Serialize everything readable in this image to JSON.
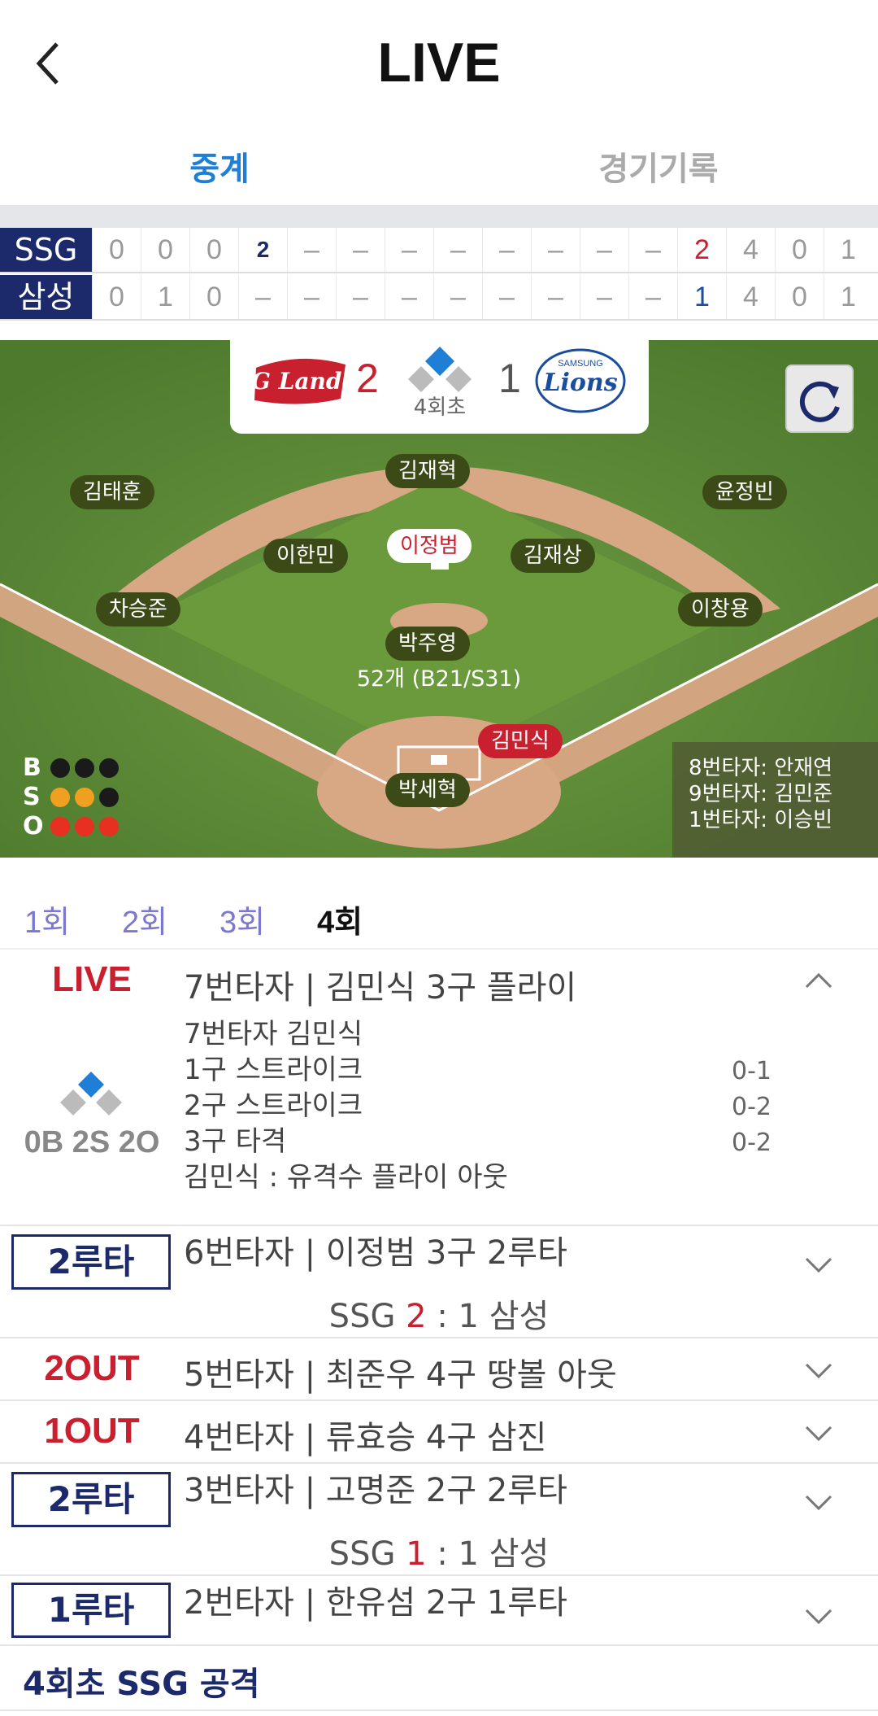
{
  "header": {
    "title": "LIVE",
    "back_icon": "back-arrow-icon"
  },
  "tabs": [
    {
      "label": "중계",
      "active": true
    },
    {
      "label": "경기기록",
      "active": false
    }
  ],
  "scoreboard": {
    "rows": [
      {
        "team": "SSG",
        "innings": [
          "0",
          "0",
          "0",
          "2",
          "–",
          "–",
          "–",
          "–",
          "–",
          "–",
          "–",
          "–"
        ],
        "totals": [
          "2",
          "4",
          "0",
          "1"
        ]
      },
      {
        "team": "삼성",
        "innings": [
          "0",
          "1",
          "0",
          "–",
          "–",
          "–",
          "–",
          "–",
          "–",
          "–",
          "–",
          "–"
        ],
        "totals": [
          "1",
          "4",
          "0",
          "1"
        ]
      }
    ]
  },
  "game": {
    "away_logo": "SSG Landers",
    "away_score": "2",
    "inning": "4회초",
    "home_score": "1",
    "home_logo": "Lions",
    "home_logo_sub": "SAMSUNG",
    "refresh_icon": "refresh-icon"
  },
  "field": {
    "cf": "김재혁",
    "lf": "김태훈",
    "rf": "윤정빈",
    "ss": "이한민",
    "runner2b": "이정범",
    "b2": "김재상",
    "b3": "차승준",
    "b1": "이창용",
    "pitcher": "박주영",
    "pitch_count": "52개 (B21/S31)",
    "batter": "김민식",
    "catcher": "박세혁",
    "next_batters": [
      "8번타자: 안재연",
      "9번타자: 김민준",
      "1번타자: 이승빈"
    ],
    "count_labels": [
      "B",
      "S",
      "O"
    ]
  },
  "innings_tabs": [
    "1회",
    "2회",
    "3회",
    "4회"
  ],
  "plays": {
    "live": {
      "badge": "LIVE",
      "title": "7번타자 | 김민식 3구 플라이",
      "count_display": "0B 2S 2O",
      "details": [
        "7번타자 김민식",
        "1구 스트라이크",
        "2구 스트라이크",
        "3구 타격",
        "김민식 : 유격수 플라이 아웃"
      ],
      "counts": [
        "0-1",
        "0-2",
        "0-2"
      ]
    },
    "p2": {
      "badge": "2루타",
      "title": "6번타자 | 이정범 3구 2루타",
      "score_team_a": "SSG",
      "score_a": "2",
      "score_sep": ":",
      "score_b": "1",
      "score_team_b": "삼성"
    },
    "p3": {
      "badge": "2OUT",
      "title": "5번타자 | 최준우 4구 땅볼 아웃"
    },
    "p4": {
      "badge": "1OUT",
      "title": "4번타자 | 류효승 4구 삼진"
    },
    "p5": {
      "badge": "2루타",
      "title": "3번타자 | 고명준 2구 2루타",
      "score_team_a": "SSG",
      "score_a": "1",
      "score_sep": ":",
      "score_b": "1",
      "score_team_b": "삼성"
    },
    "p6": {
      "badge": "1루타",
      "title": "2번타자 | 한유섬 2구 1루타"
    },
    "section": "4회초 SSG 공격"
  },
  "colors": {
    "navy": "#1c2a6b",
    "blue": "#1f7fd6",
    "red": "#c8202f",
    "field": "#5b8a37"
  }
}
